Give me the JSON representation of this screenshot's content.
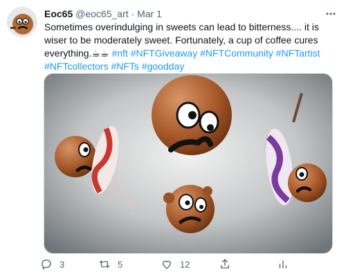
{
  "tweet": {
    "author_name": "Eoc65",
    "author_handle": "@eoc65_art",
    "separator": "·",
    "date": "Mar 1",
    "text_plain": "Sometimes overindulging in sweets can lead to bitterness.... it is wiser to be moderately sweet. Fortunately, a cup of coffee cures everything.",
    "text_emoji": "☕☕",
    "hashtags": [
      "#nft",
      "#NFTGiveaway",
      "#NFTCommunity",
      "#NFTartist",
      "#NFTcollectors",
      "#NFTs",
      "#goodday"
    ]
  },
  "actions": {
    "reply_count": "3",
    "retweet_count": "5",
    "like_count": "12"
  },
  "icons": {
    "more": "more-dots-icon",
    "reply": "reply-icon",
    "retweet": "retweet-icon",
    "like": "heart-icon",
    "share": "share-icon",
    "analytics": "analytics-icon"
  },
  "colors": {
    "link": "#1d9bf0",
    "secondary_text": "#536471",
    "face_brown": "#a85a2c"
  }
}
